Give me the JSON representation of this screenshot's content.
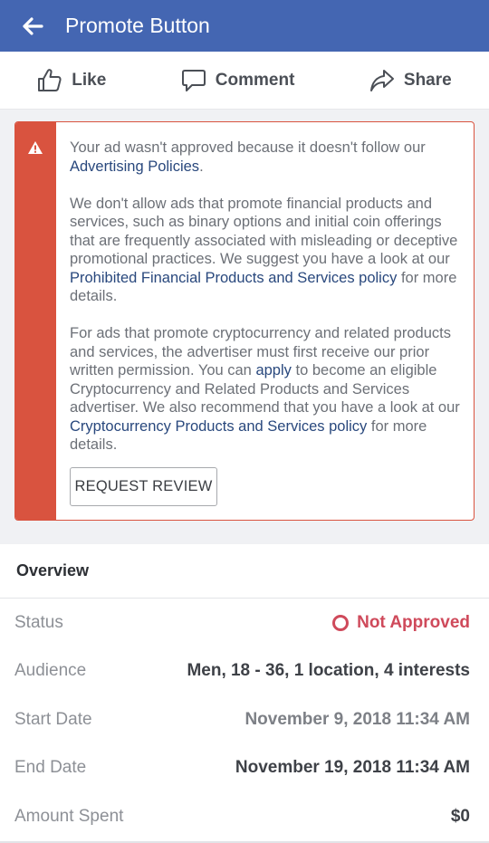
{
  "header": {
    "title": "Promote Button",
    "back_icon": "back-arrow-icon",
    "background": "#4466b2"
  },
  "actions": [
    {
      "label": "Like",
      "icon": "thumbs-up-icon"
    },
    {
      "label": "Comment",
      "icon": "comment-bubble-icon"
    },
    {
      "label": "Share",
      "icon": "share-arrow-icon"
    }
  ],
  "alert": {
    "icon": "warning-triangle-icon",
    "accent": "#d9533f",
    "p1_text": "Your ad wasn't approved because it doesn't follow our ",
    "p1_link": "Advertising Policies",
    "p1_end": ".",
    "p2_text": " We don't allow ads that promote financial products and services, such as binary options and initial coin offerings that are frequently associated with misleading or deceptive promotional practices. We suggest you have a look at our ",
    "p2_link": "Prohibited Financial Products and Services policy",
    "p2_end": " for more details.",
    "p3_text": " For ads that promote cryptocurrency and related products and services, the advertiser must first receive our prior written permission. You can ",
    "p3_link1": "apply",
    "p3_mid": " to become an eligible Cryptocurrency and Related Products and Services advertiser. We also recommend that you have a look at our ",
    "p3_link2": "Cryptocurrency Products and Services policy",
    "p3_end": " for more details.",
    "button_label": "REQUEST REVIEW"
  },
  "overview": {
    "heading": "Overview",
    "status_label": "Status",
    "status_value": "Not Approved",
    "status_color": "#cf4a5b",
    "audience_label": "Audience",
    "audience_value": "Men, 18 - 36, 1 location, 4 interests",
    "start_label": "Start Date",
    "start_value": "November 9, 2018 11:34 AM",
    "end_label": "End Date",
    "end_value": "November 19, 2018 11:34 AM",
    "spent_label": "Amount Spent",
    "spent_value": "$0"
  }
}
